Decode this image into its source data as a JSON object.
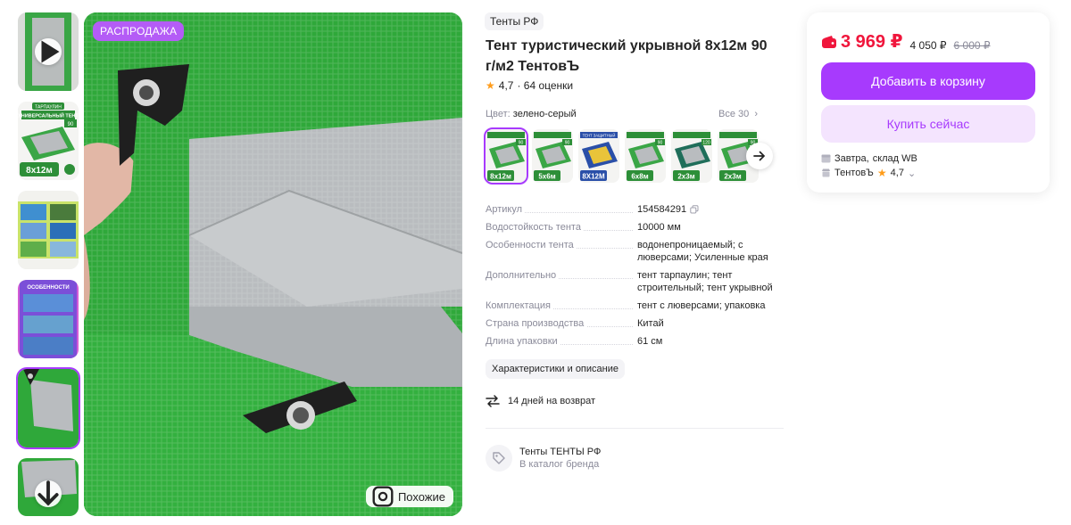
{
  "gallery": {
    "sale_badge": "РАСПРОДАЖА",
    "similar_label": "Похожие",
    "thumb_labels": {
      "tarpaulin_top": "ТАРПАУЛИН",
      "tarpaulin_name": "УНИВЕРСАЛЬНЫЙ ТЕНТ",
      "density": "90",
      "size": "8x12м",
      "features_title": "ОСОБЕННОСТИ"
    }
  },
  "product": {
    "brand_chip": "Тенты РФ",
    "title": "Тент туристический укрывной 8х12м 90 г/м2 ТентовЪ",
    "rating": "4,7",
    "ratings_count": "· 64 оценки"
  },
  "colors": {
    "label": "Цвет:",
    "value": "зелено-серый",
    "all_link": "Все 30",
    "swatches": [
      {
        "size": "8x12м",
        "density": "90"
      },
      {
        "size": "5x6м",
        "density": "90"
      },
      {
        "size": "8X12М",
        "title": "ТЕНТ ЗАЩИТНЫЙ"
      },
      {
        "size": "6x8м",
        "density": "90"
      },
      {
        "size": "2x3м",
        "density": "120"
      },
      {
        "size": "2x3м",
        "density": "90"
      }
    ]
  },
  "specs": [
    {
      "name": "Артикул",
      "value": "154584291"
    },
    {
      "name": "Водостойкость тента",
      "value": "10000 мм"
    },
    {
      "name": "Особенности тента",
      "value": "водонепроницаемый; с люверсами; Усиленные края"
    },
    {
      "name": "Дополнительно",
      "value": "тент тарпаулин; тент строительный; тент укрывной"
    },
    {
      "name": "Комплектация",
      "value": "тент с люверсами; упаковка"
    },
    {
      "name": "Страна производства",
      "value": "Китай"
    },
    {
      "name": "Длина упаковки",
      "value": "61 см"
    }
  ],
  "description_button": "Характеристики и описание",
  "return_text": "14 дней на возврат",
  "brand_block": {
    "name": "Тенты ТЕНТЫ РФ",
    "link": "В каталог бренда"
  },
  "price_card": {
    "price": "3 969 ₽",
    "old_price": "4 050 ₽",
    "original_price": "6 000 ₽",
    "add_to_cart": "Добавить в корзину",
    "buy_now": "Купить сейчас",
    "delivery_day": "Завтра,",
    "delivery_place": "склад WB",
    "seller_name": "ТентовЪ",
    "seller_rating": "4,7"
  },
  "colors_theme": {
    "accent": "#a73afd",
    "price": "#f0163c",
    "tarp_green": "#2fa83a",
    "tarp_silver": "#b9bcbf"
  }
}
